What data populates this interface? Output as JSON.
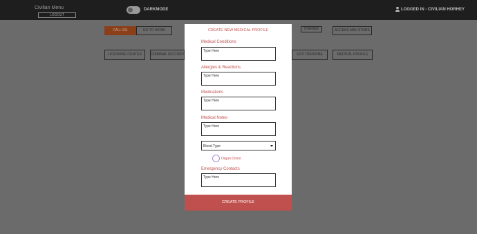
{
  "header": {
    "app_title": "Civilian Menu",
    "logout_label": "LOGOUT",
    "darkmode_label": "DARKMODE",
    "user_label": "LOGGED IN - CIVILIAN HORHEY"
  },
  "background_buttons": {
    "call911": "CALL 911",
    "go_to_work": "GO TO WORK",
    "change": "CHANGE",
    "access_mav_store": "ACCESS MAV STORE",
    "licensing_center": "LICENSING CENTER",
    "criminal_records": "CRIMINAL RECORDS",
    "edit_persona": "EDIT PERSONA",
    "medical_profile": "MEDICAL PROFILE"
  },
  "modal": {
    "title": "CREATE NEW MEDICAL PROFILE",
    "fields": [
      {
        "label": "Medical Conditions",
        "placeholder": "Type Here"
      },
      {
        "label": "Allergies & Reactions",
        "placeholder": "Type Here"
      },
      {
        "label": "Medications",
        "placeholder": "Type Here"
      },
      {
        "label": "Medical Notes",
        "placeholder": "Type Here"
      }
    ],
    "blood_type": {
      "value": "Blood Type"
    },
    "organ_donor_label": "Organ Donor",
    "emergency_contacts": {
      "label": "Emergency Contacts",
      "placeholder": "Type Here"
    },
    "create_button": "CREATE PROFILE"
  },
  "colors": {
    "accent": "#c0504d",
    "topbar": "#1e1e1e",
    "overlay": "#6b6b6b"
  }
}
